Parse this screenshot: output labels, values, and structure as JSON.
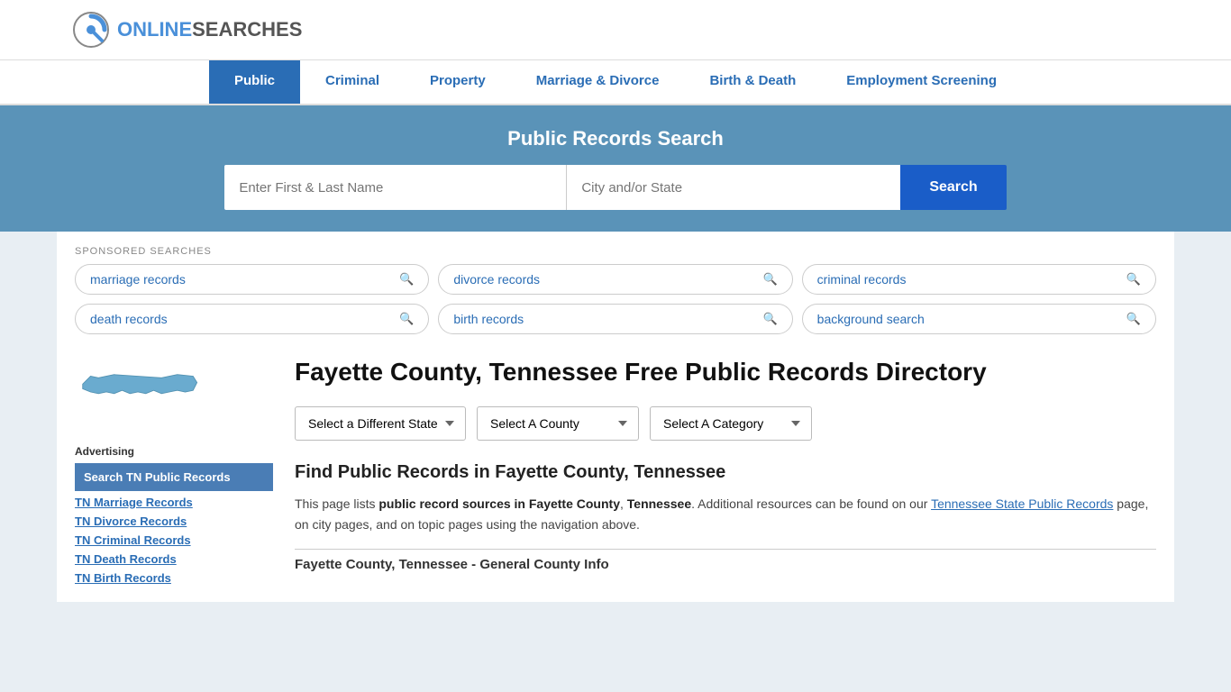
{
  "header": {
    "logo_online": "ONLINE",
    "logo_searches": "SEARCHES",
    "logo_alt": "OnlineSearches Logo"
  },
  "nav": {
    "items": [
      {
        "label": "Public",
        "active": true
      },
      {
        "label": "Criminal",
        "active": false
      },
      {
        "label": "Property",
        "active": false
      },
      {
        "label": "Marriage & Divorce",
        "active": false
      },
      {
        "label": "Birth & Death",
        "active": false
      },
      {
        "label": "Employment Screening",
        "active": false
      }
    ]
  },
  "search_banner": {
    "title": "Public Records Search",
    "name_placeholder": "Enter First & Last Name",
    "city_placeholder": "City and/or State",
    "search_label": "Search"
  },
  "sponsored": {
    "label": "SPONSORED SEARCHES",
    "pills": [
      {
        "label": "marriage records"
      },
      {
        "label": "divorce records"
      },
      {
        "label": "criminal records"
      },
      {
        "label": "death records"
      },
      {
        "label": "birth records"
      },
      {
        "label": "background search"
      }
    ]
  },
  "sidebar": {
    "ad_label": "Advertising",
    "ad_active": "Search TN Public Records",
    "links": [
      {
        "label": "TN Marriage Records"
      },
      {
        "label": "TN Divorce Records"
      },
      {
        "label": "TN Criminal Records"
      },
      {
        "label": "TN Death Records"
      },
      {
        "label": "TN Birth Records"
      }
    ]
  },
  "article": {
    "title": "Fayette County, Tennessee Free Public Records Directory",
    "dropdowns": {
      "state": "Select a Different State",
      "county": "Select A County",
      "category": "Select A Category"
    },
    "find_title": "Find Public Records in Fayette County, Tennessee",
    "find_desc_1": "This page lists ",
    "find_desc_bold1": "public record sources in Fayette County",
    "find_desc_2": ", ",
    "find_desc_bold2": "Tennessee",
    "find_desc_3": ". Additional resources can be found on our ",
    "find_desc_link": "Tennessee State Public Records",
    "find_desc_4": " page, on city pages, and on topic pages using the navigation above.",
    "county_info_title": "Fayette County, Tennessee - General County Info"
  }
}
